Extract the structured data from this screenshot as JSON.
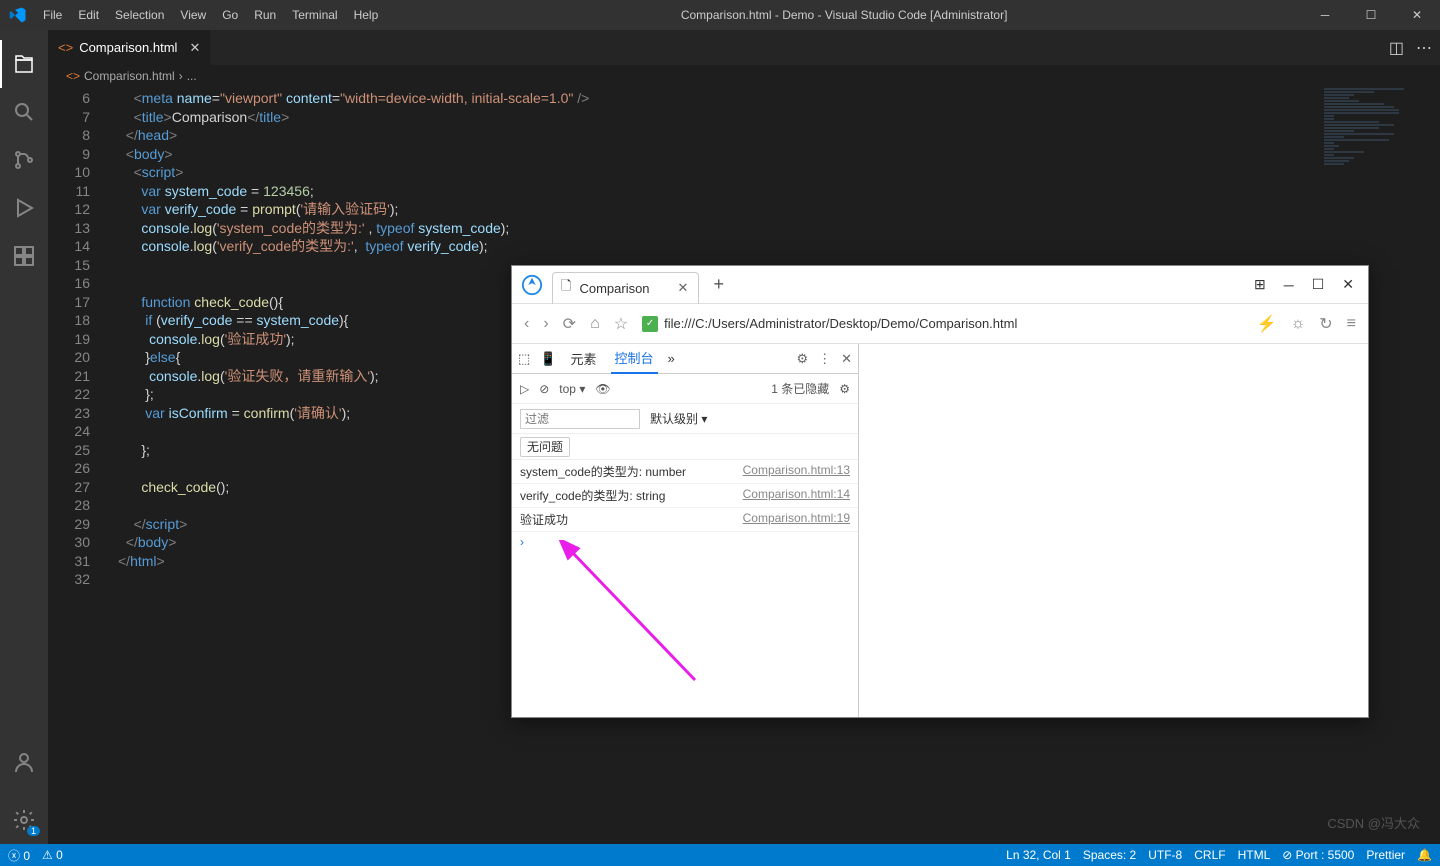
{
  "titlebar": {
    "menus": [
      "File",
      "Edit",
      "Selection",
      "View",
      "Go",
      "Run",
      "Terminal",
      "Help"
    ],
    "title": "Comparison.html - Demo - Visual Studio Code [Administrator]"
  },
  "tabs": {
    "tab1": "Comparison.html"
  },
  "breadcrumb": {
    "file": "Comparison.html",
    "sep": "›",
    "more": "..."
  },
  "code": {
    "lines": [
      "6",
      "7",
      "8",
      "9",
      "10",
      "11",
      "12",
      "13",
      "14",
      "15",
      "16",
      "17",
      "18",
      "19",
      "20",
      "21",
      "22",
      "23",
      "24",
      "25",
      "26",
      "27",
      "28",
      "29",
      "30",
      "31",
      "32"
    ]
  },
  "statusbar": {
    "errors": "0",
    "warnings": "0",
    "pos": "Ln 32, Col 1",
    "spaces": "Spaces: 2",
    "enc": "UTF-8",
    "eol": "CRLF",
    "lang": "HTML",
    "port": "Port : 5500",
    "prettier": "Prettier"
  },
  "browser": {
    "tabTitle": "Comparison",
    "url": "file:///C:/Users/Administrator/Desktop/Demo/Comparison.html",
    "devtabs": {
      "elements": "元素",
      "console": "控制台"
    },
    "toolbar": {
      "top": "top ▾",
      "hidden": "1 条已隐藏"
    },
    "filter": {
      "placeholder": "过滤",
      "level": "默认级别 ▾"
    },
    "issues": "无问题",
    "console": {
      "r1msg": "system_code的类型为: number",
      "r1src": "Comparison.html:13",
      "r2msg": "verify_code的类型为: string",
      "r2src": "Comparison.html:14",
      "r3msg": "验证成功",
      "r3src": "Comparison.html:19"
    }
  },
  "watermark": "CSDN @冯大众"
}
